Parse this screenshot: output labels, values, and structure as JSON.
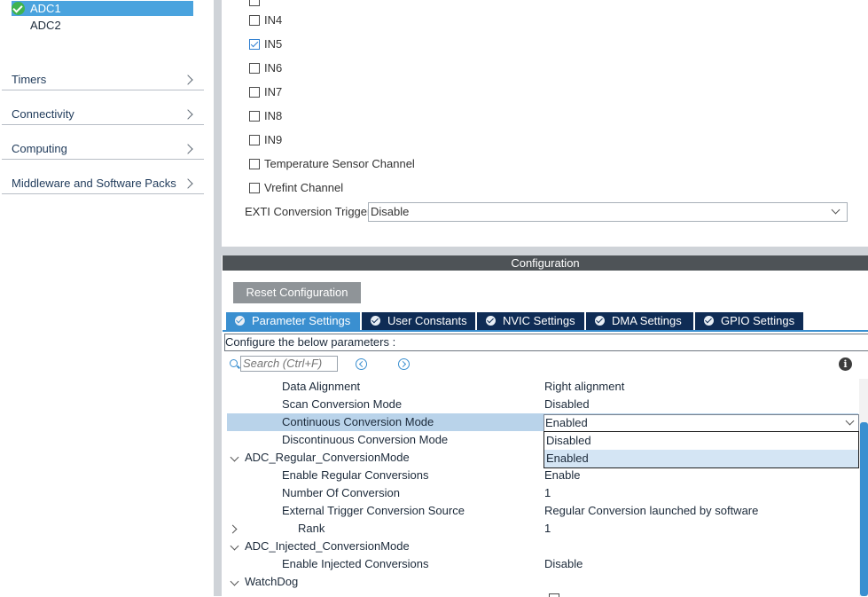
{
  "sidebar": {
    "tree": [
      {
        "label": "ADC1",
        "checked": true,
        "selected": true
      },
      {
        "label": "ADC2",
        "checked": false,
        "selected": false
      }
    ],
    "categories": [
      {
        "label": "Timers"
      },
      {
        "label": "Connectivity"
      },
      {
        "label": "Computing"
      },
      {
        "label": "Middleware and Software Packs"
      }
    ]
  },
  "channels": [
    {
      "label": "IN4",
      "checked": false
    },
    {
      "label": "IN5",
      "checked": true
    },
    {
      "label": "IN6",
      "checked": false
    },
    {
      "label": "IN7",
      "checked": false
    },
    {
      "label": "IN8",
      "checked": false
    },
    {
      "label": "IN9",
      "checked": false
    },
    {
      "label": "Temperature Sensor Channel",
      "checked": false
    },
    {
      "label": "Vrefint Channel",
      "checked": false
    }
  ],
  "exti": {
    "label": "EXTI Conversion Trigger",
    "value": "Disable"
  },
  "configuration": {
    "title": "Configuration",
    "reset_label": "Reset Configuration",
    "tabs": [
      {
        "label": "Parameter Settings",
        "active": true
      },
      {
        "label": "User Constants",
        "active": false
      },
      {
        "label": "NVIC Settings",
        "active": false
      },
      {
        "label": "DMA Settings",
        "active": false
      },
      {
        "label": "GPIO Settings",
        "active": false
      }
    ],
    "hint": "Configure the below parameters :",
    "search_placeholder": "Search (Ctrl+F)"
  },
  "params": [
    {
      "key": "Data Alignment",
      "value": "Right alignment"
    },
    {
      "key": "Scan Conversion Mode",
      "value": "Disabled"
    },
    {
      "key": "Continuous Conversion Mode",
      "value": "Enabled"
    },
    {
      "key": "Discontinuous Conversion Mode",
      "value": ""
    },
    {
      "key": "ADC_Regular_ConversionMode",
      "value": ""
    },
    {
      "key": "Enable Regular Conversions",
      "value": "Enable"
    },
    {
      "key": "Number Of Conversion",
      "value": "1"
    },
    {
      "key": "External Trigger Conversion Source",
      "value": "Regular Conversion launched by software"
    },
    {
      "key": "Rank",
      "value": "1"
    },
    {
      "key": "ADC_Injected_ConversionMode",
      "value": ""
    },
    {
      "key": "Enable Injected Conversions",
      "value": "Disable"
    },
    {
      "key": "WatchDog",
      "value": ""
    }
  ],
  "dropdown": {
    "selected": "Enabled",
    "options": [
      "Disabled",
      "Enabled"
    ]
  },
  "colors": {
    "accent": "#3a8fd0",
    "tab_bg": "#0f2c55",
    "selection": "#b9d3ea"
  }
}
